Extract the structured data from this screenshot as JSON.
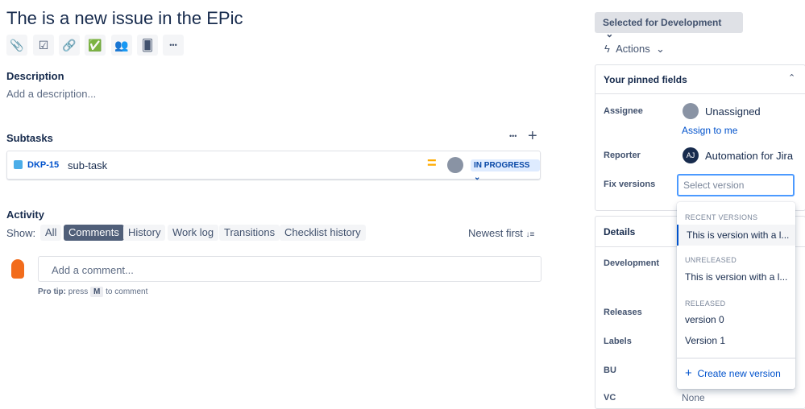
{
  "issue": {
    "title": "The is a new issue in the EPic"
  },
  "toolbar": {
    "icons": [
      "attach-icon",
      "subtask-icon",
      "link-icon",
      "checklist-icon",
      "team-icon",
      "cards-icon",
      "more-icon"
    ],
    "more": "•••"
  },
  "description": {
    "heading": "Description",
    "placeholder": "Add a description..."
  },
  "subtasks": {
    "heading": "Subtasks",
    "more": "•••",
    "add": "+",
    "items": [
      {
        "key": "DKP-15",
        "summary": "sub-task",
        "priority": "=",
        "status": "IN PROGRESS"
      }
    ]
  },
  "activity": {
    "heading": "Activity",
    "show_label": "Show:",
    "filters": [
      "All",
      "Comments",
      "History",
      "Work log",
      "Transitions",
      "Checklist history"
    ],
    "selected": "Comments",
    "sort": "Newest first",
    "sort_icon": "↓≡",
    "comment_placeholder": "Add a comment...",
    "protip_bold": "Pro tip:",
    "protip_press": "press",
    "protip_key": "M",
    "protip_rest": "to comment"
  },
  "status_button": "Selected for Development",
  "actions": "Actions",
  "pinned": {
    "heading": "Your pinned fields",
    "assignee_label": "Assignee",
    "assignee": "Unassigned",
    "assign_to_me": "Assign to me",
    "reporter_label": "Reporter",
    "reporter_initials": "AJ",
    "reporter": "Automation for Jira",
    "fix_label": "Fix versions",
    "fix_placeholder": "Select version"
  },
  "details": {
    "heading": "Details",
    "rows": [
      "Development",
      "Releases",
      "Labels",
      "BU",
      "VC"
    ],
    "vc_value": "None"
  },
  "dropdown": {
    "recent_heading": "RECENT VERSIONS",
    "recent": [
      "This is version with a l..."
    ],
    "unreleased_heading": "UNRELEASED",
    "unreleased": [
      "This is version with a l..."
    ],
    "released_heading": "RELEASED",
    "released": [
      "version 0",
      "Version 1"
    ],
    "create": "Create new version"
  },
  "colors": {
    "accent": "#0052cc",
    "status_bg": "#deebff",
    "priority": "#ffab00",
    "selected_pill": "#505f79"
  }
}
